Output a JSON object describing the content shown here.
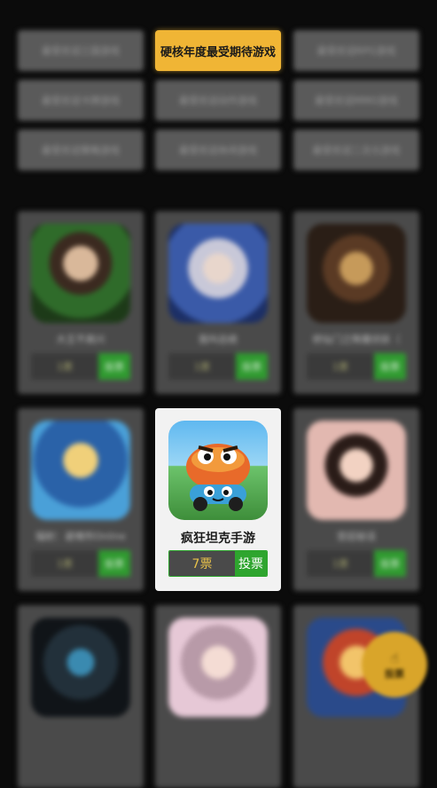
{
  "categories": [
    {
      "label": "最受欢迎三国游戏"
    },
    {
      "label": "硬核年度最受期待游戏"
    },
    {
      "label": "最受欢迎RPG游戏"
    },
    {
      "label": "最受欢迎卡牌游戏"
    },
    {
      "label": "最受欢迎动作游戏"
    },
    {
      "label": "最受欢迎MMO游戏"
    },
    {
      "label": "最受欢迎策略游戏"
    },
    {
      "label": "最受欢迎休闲游戏"
    },
    {
      "label": "最受欢迎二次元游戏"
    }
  ],
  "games": [
    {
      "name": "大王不高兴",
      "votes": "1票",
      "vote_button": "投票",
      "icon": "anime-warrior-icon"
    },
    {
      "name": "我叫总统",
      "votes": "1票",
      "vote_button": "投票",
      "icon": "silver-hair-hero-icon"
    },
    {
      "name": "修仙门之降魔伏妖（",
      "votes": "1票",
      "vote_button": "投票",
      "icon": "golden-warrior-icon"
    },
    {
      "name": "辐射：避难所Online",
      "votes": "1票",
      "vote_button": "投票",
      "icon": "vault-boy-icon"
    },
    {
      "name": "疯狂坦克手游",
      "votes": "7票",
      "vote_button": "投票",
      "icon": "tank-mascot-icon"
    },
    {
      "name": "宫廷秘话",
      "votes": "1票",
      "vote_button": "投票",
      "icon": "palace-lady-icon"
    },
    {
      "name": "",
      "votes": "",
      "vote_button": "",
      "icon": "dark-knight-icon"
    },
    {
      "name": "",
      "votes": "",
      "vote_button": "",
      "icon": "fairy-lady-icon"
    },
    {
      "name": "",
      "votes": "",
      "vote_button": "",
      "icon": "pirate-cartoon-icon"
    }
  ],
  "fab": {
    "label": "投票",
    "icon": "hand-icon"
  },
  "colors": {
    "accent": "#f0b535",
    "vote_green": "#2ea52e"
  }
}
